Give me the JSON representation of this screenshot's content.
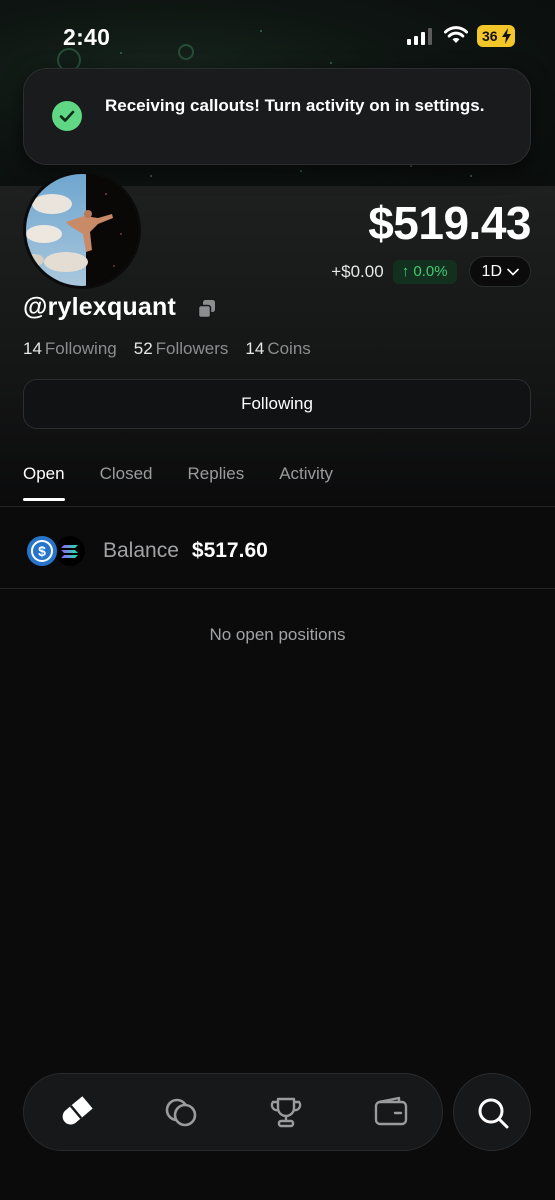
{
  "status_bar": {
    "time": "2:40",
    "battery": "36"
  },
  "toast": {
    "message": "Receiving callouts! Turn activity on in settings."
  },
  "profile": {
    "balance": "$519.43",
    "change_abs": "+$0.00",
    "change_pct": "↑ 0.0%",
    "range": "1D",
    "username": "@rylexquant",
    "stats": [
      {
        "num": "14",
        "label": "Following"
      },
      {
        "num": "52",
        "label": "Followers"
      },
      {
        "num": "14",
        "label": "Coins"
      }
    ],
    "follow_button": "Following"
  },
  "tabs": [
    {
      "label": "Open",
      "active": true
    },
    {
      "label": "Closed",
      "active": false
    },
    {
      "label": "Replies",
      "active": false
    },
    {
      "label": "Activity",
      "active": false
    }
  ],
  "wallet": {
    "balance_label": "Balance",
    "balance_value": "$517.60"
  },
  "positions": {
    "empty_text": "No open positions"
  },
  "nav": {
    "items": [
      "pill-icon",
      "coins-icon",
      "trophy-icon",
      "wallet-icon"
    ],
    "search": "search-icon"
  },
  "colors": {
    "accent_green": "#47c874",
    "toast_check": "#5fd784",
    "battery": "#f3c629",
    "usdc_blue": "#2775ca"
  }
}
